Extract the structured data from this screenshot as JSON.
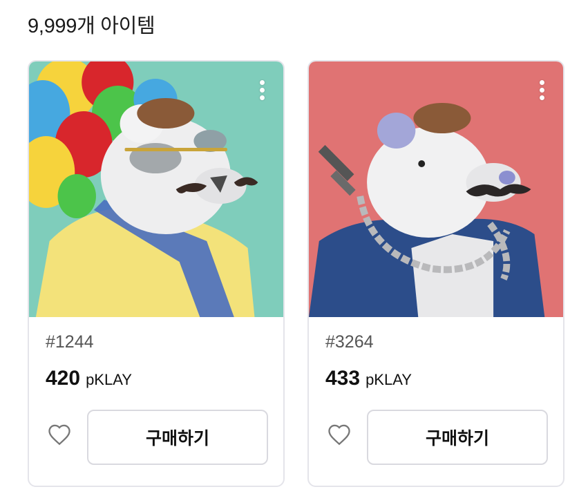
{
  "header": {
    "item_count_label": "9,999개 아이템"
  },
  "items": [
    {
      "token_id": "#1244",
      "price_value": "420",
      "price_unit": "pKLAY",
      "buy_label": "구매하기",
      "background_color": "#7fcdbb"
    },
    {
      "token_id": "#3264",
      "price_value": "433",
      "price_unit": "pKLAY",
      "buy_label": "구매하기",
      "background_color": "#e07373"
    }
  ],
  "icons": {
    "more": "more-vertical-icon",
    "like": "heart-outline-icon"
  }
}
